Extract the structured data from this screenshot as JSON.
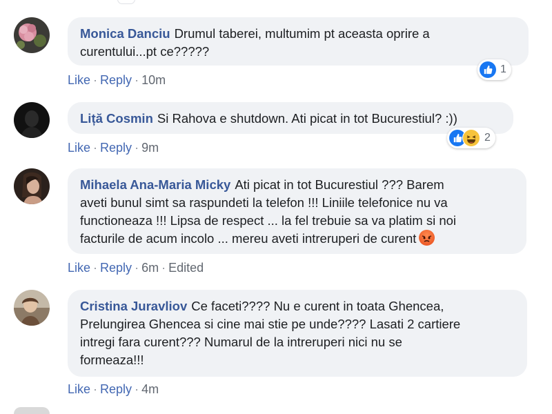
{
  "comments": [
    {
      "author": "Monica Danciu",
      "text": "Drumul taberei, multumim pt aceasta oprire a\ncurentului...pt ce?????",
      "like_label": "Like",
      "reply_label": "Reply",
      "time": "10m",
      "reaction_count": "1",
      "reactions": [
        "like-icon"
      ]
    },
    {
      "author": "Liță Cosmin",
      "text": "Si Rahova e shutdown. Ati picat in tot Bucurestiul? :))",
      "like_label": "Like",
      "reply_label": "Reply",
      "time": "9m",
      "reaction_count": "2",
      "reactions": [
        "like-icon",
        "haha-icon"
      ]
    },
    {
      "author": "Mihaela Ana-Maria Micky",
      "text": "Ati picat in tot Bucurestiul ??? Barem\naveti bunul simt sa raspundeti la telefon !!! Liniile telefonice nu va\nfunctioneaza !!! Lipsa de respect ... la fel trebuie sa va platim si noi\nfacturile de acum incolo ... mereu aveti intreruperi de curent",
      "like_label": "Like",
      "reply_label": "Reply",
      "time": "6m",
      "edited_label": "Edited",
      "trailing_emoji": "angry-face-icon"
    },
    {
      "author": "Cristina Juravliov",
      "text": "Ce faceti???? Nu e curent in toata Ghencea,\nPrelungirea Ghencea si cine mai stie pe unde???? Lasati 2 cartiere\nintregi fara curent??? Numarul de la intreruperi nici nu se\nformeaza!!!",
      "like_label": "Like",
      "reply_label": "Reply",
      "time": "4m"
    }
  ],
  "colors": {
    "author": "#385898",
    "link": "#4267b2",
    "bubble_bg": "#f0f2f5",
    "meta": "#616770",
    "like_blue": "#1877f2"
  }
}
